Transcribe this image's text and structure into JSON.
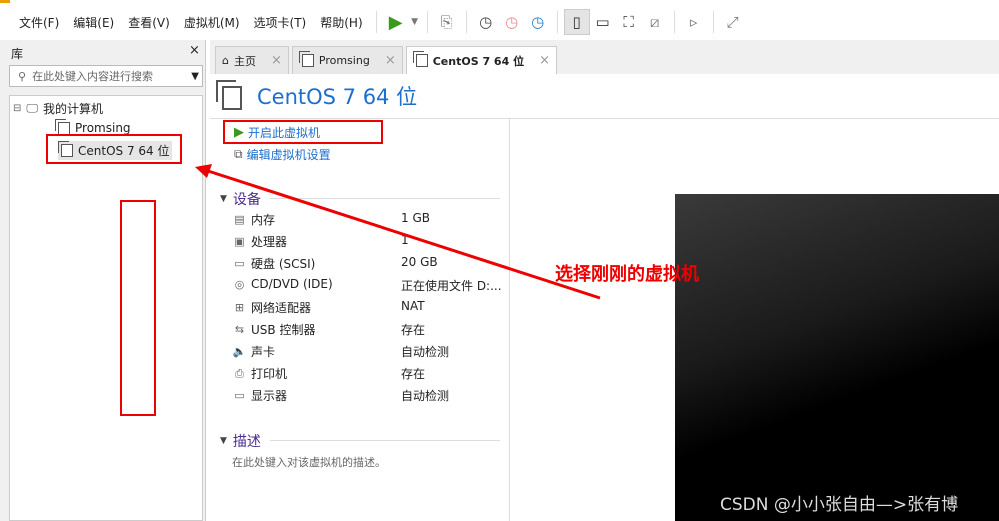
{
  "menu": [
    "文件(F)",
    "编辑(E)",
    "查看(V)",
    "虚拟机(M)",
    "选项卡(T)",
    "帮助(H)"
  ],
  "library": {
    "title": "库",
    "close": "×",
    "search_placeholder": "在此处键入内容进行搜索",
    "tree": {
      "root": "我的计算机",
      "items": [
        "Promsing",
        "CentOS 7 64 位"
      ]
    }
  },
  "tabs": [
    {
      "label": "主页"
    },
    {
      "label": "Promsing"
    },
    {
      "label": "CentOS 7 64 位"
    }
  ],
  "vm": {
    "title": "CentOS 7 64 位",
    "actions": {
      "power_on": "开启此虚拟机",
      "edit": "编辑虚拟机设置"
    },
    "devices_header": "设备",
    "devices": [
      {
        "name": "内存",
        "value": "1 GB",
        "icon": "memory-icon"
      },
      {
        "name": "处理器",
        "value": "1",
        "icon": "cpu-icon"
      },
      {
        "name": "硬盘 (SCSI)",
        "value": "20 GB",
        "icon": "disk-icon"
      },
      {
        "name": "CD/DVD (IDE)",
        "value": "正在使用文件 D:...",
        "icon": "cd-icon"
      },
      {
        "name": "网络适配器",
        "value": "NAT",
        "icon": "network-icon"
      },
      {
        "name": "USB 控制器",
        "value": "存在",
        "icon": "usb-icon"
      },
      {
        "name": "声卡",
        "value": "自动检测",
        "icon": "sound-icon"
      },
      {
        "name": "打印机",
        "value": "存在",
        "icon": "printer-icon"
      },
      {
        "name": "显示器",
        "value": "自动检测",
        "icon": "monitor-icon"
      }
    ],
    "description_header": "描述",
    "description_placeholder": "在此处键入对该虚拟机的描述。"
  },
  "annotation": "选择刚刚的虚拟机",
  "watermark": "CSDN @小小张自由—>张有博",
  "colors": {
    "accent": "#1b6fcf",
    "annotation": "#ee0000"
  }
}
